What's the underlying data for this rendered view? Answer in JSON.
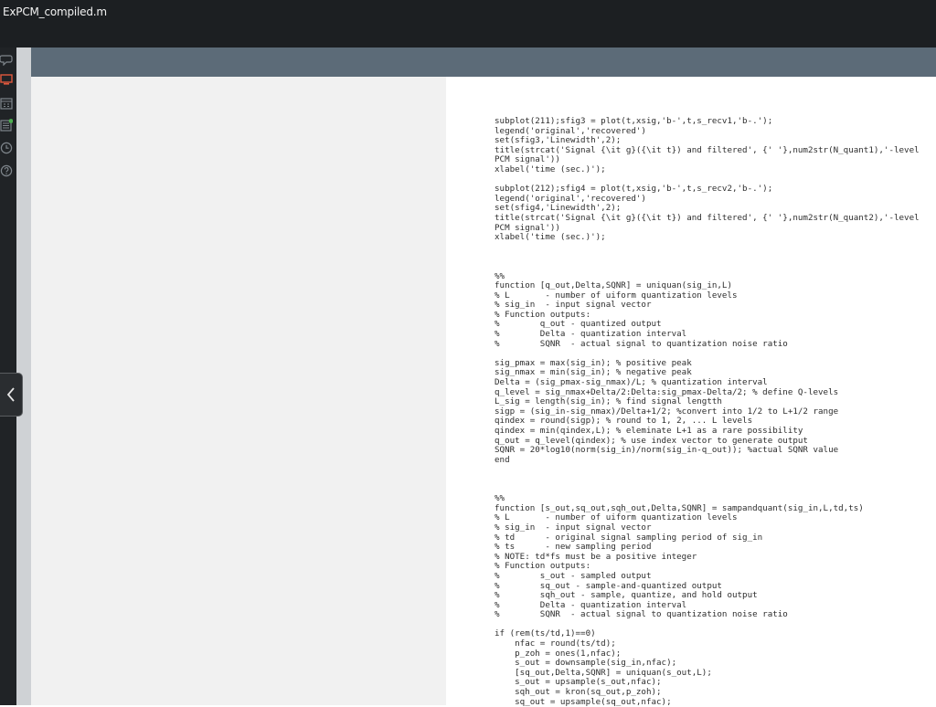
{
  "window": {
    "title": "ExPCM_compiled.m"
  },
  "sidebar": {
    "icons": [
      "chat-icon",
      "screen-icon",
      "calendar-icon",
      "list-icon",
      "clock-icon",
      "help-icon"
    ]
  },
  "navigation": {
    "collapse_icon": "chevron-left-icon"
  },
  "document": {
    "lines": [
      "subplot(211);sfig3 = plot(t,xsig,'b-',t,s_recv1,'b-.');",
      "legend('original','recovered')",
      "set(sfig3,'Linewidth',2);",
      "title(strcat('Signal {\\it g}({\\it t}) and filtered', {' '},num2str(N_quant1),'-level",
      "PCM signal'))",
      "xlabel('time (sec.)');",
      "",
      "subplot(212);sfig4 = plot(t,xsig,'b-',t,s_recv2,'b-.');",
      "legend('original','recovered')",
      "set(sfig4,'Linewidth',2);",
      "title(strcat('Signal {\\it g}({\\it t}) and filtered', {' '},num2str(N_quant2),'-level",
      "PCM signal'))",
      "xlabel('time (sec.)');",
      "",
      "",
      "",
      "%%",
      "function [q_out,Delta,SQNR] = uniquan(sig_in,L)",
      "% L       - number of uiform quantization levels",
      "% sig_in  - input signal vector",
      "% Function outputs:",
      "%        q_out - quantized output",
      "%        Delta - quantization interval",
      "%        SQNR  - actual signal to quantization noise ratio",
      "",
      "sig_pmax = max(sig_in); % positive peak",
      "sig_nmax = min(sig_in); % negative peak",
      "Delta = (sig_pmax-sig_nmax)/L; % quantization interval",
      "q_level = sig_nmax+Delta/2:Delta:sig_pmax-Delta/2; % define Q-levels",
      "L_sig = length(sig_in); % find signal lengtth",
      "sigp = (sig_in-sig_nmax)/Delta+1/2; %convert into 1/2 to L+1/2 range",
      "qindex = round(sigp); % round to 1, 2, ... L levels",
      "qindex = min(qindex,L); % eleminate L+1 as a rare possibility",
      "q_out = q_level(qindex); % use index vector to generate output",
      "SQNR = 20*log10(norm(sig_in)/norm(sig_in-q_out)); %actual SQNR value",
      "end",
      "",
      "",
      "",
      "%%",
      "function [s_out,sq_out,sqh_out,Delta,SQNR] = sampandquant(sig_in,L,td,ts)",
      "% L       - number of uiform quantization levels",
      "% sig_in  - input signal vector",
      "% td      - original signal sampling period of sig_in",
      "% ts      - new sampling period",
      "% NOTE: td*fs must be a positive integer",
      "% Function outputs:",
      "%        s_out - sampled output",
      "%        sq_out - sample-and-quantized output",
      "%        sqh_out - sample, quantize, and hold output",
      "%        Delta - quantization interval",
      "%        SQNR  - actual signal to quantization noise ratio",
      "",
      "if (rem(ts/td,1)==0)",
      "    nfac = round(ts/td);",
      "    p_zoh = ones(1,nfac);",
      "    s_out = downsample(sig_in,nfac);",
      "    [sq_out,Delta,SQNR] = uniquan(s_out,L);",
      "    s_out = upsample(s_out,nfac);",
      "    sqh_out = kron(sq_out,p_zoh);",
      "    sq_out = upsample(sq_out,nfac);"
    ]
  }
}
